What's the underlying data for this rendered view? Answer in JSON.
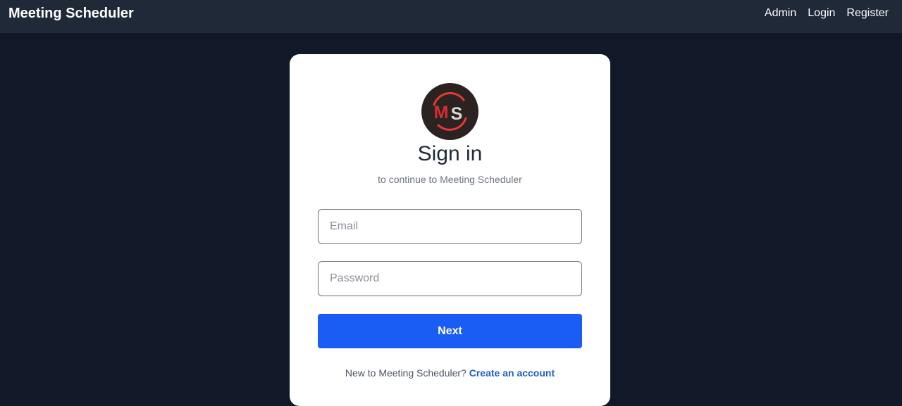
{
  "navbar": {
    "brand": "Meeting Scheduler",
    "links": [
      "Admin",
      "Login",
      "Register"
    ]
  },
  "card": {
    "logo": {
      "letters": [
        "M",
        "S"
      ],
      "colors": {
        "background": "#2b2222",
        "m_letter": "#d32f2f",
        "s_letter": "#d9d9d9",
        "ring": "#e53935"
      }
    },
    "title": "Sign in",
    "subtitle": "to continue to Meeting Scheduler",
    "email": {
      "placeholder": "Email",
      "value": ""
    },
    "password": {
      "placeholder": "Password",
      "value": ""
    },
    "next_label": "Next",
    "signup_prompt": "New to Meeting Scheduler?",
    "signup_link": "Create an account"
  },
  "colors": {
    "page_background": "#111827",
    "navbar_background": "#1f2937",
    "primary_button": "#1a5df5",
    "link": "#1d5fc9"
  }
}
